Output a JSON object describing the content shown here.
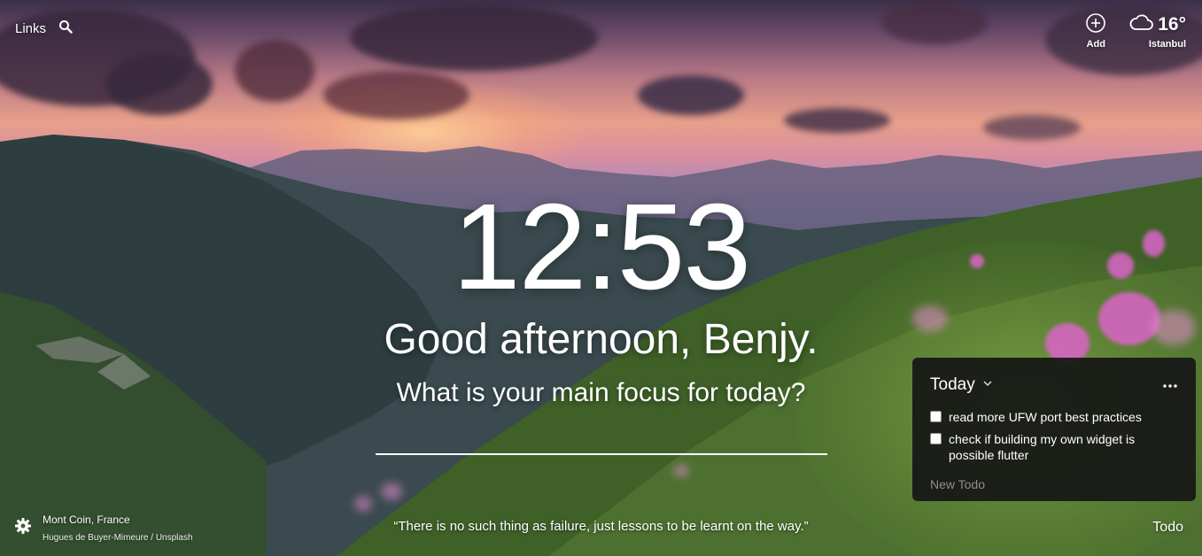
{
  "links": {
    "label": "Links",
    "search_icon": "search-icon"
  },
  "top_right": {
    "add_label": "Add",
    "add_icon": "plus-circle-icon",
    "weather_icon": "cloud-icon",
    "temperature": "16°",
    "city": "Istanbul"
  },
  "center": {
    "time": "12:53",
    "greeting": "Good afternoon, Benjy.",
    "focus_question": "What is your main focus for today?",
    "focus_value": ""
  },
  "photo": {
    "location": "Mont Coin, France",
    "credit": "Hugues de Buyer-Mimeure / Unsplash"
  },
  "quote": "“There is no such thing as failure, just lessons to be learnt on the way.”",
  "todo": {
    "title": "Today",
    "items": [
      {
        "text": "read more UFW port best practices",
        "done": false
      },
      {
        "text": "check if building my own widget is possible flutter",
        "done": false
      }
    ],
    "new_placeholder": "New Todo",
    "toggle_label": "Todo"
  }
}
